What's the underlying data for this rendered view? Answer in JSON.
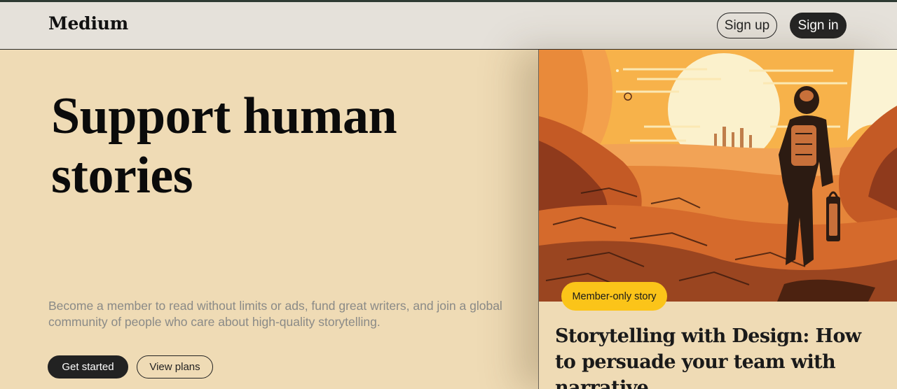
{
  "header": {
    "logo": "Medium",
    "signup_label": "Sign up",
    "signin_label": "Sign in"
  },
  "hero": {
    "title": "Support human stories",
    "subtitle": "Become a member to read without limits or ads, fund great writers, and join a global community of people who care about high-quality storytelling.",
    "get_started_label": "Get started",
    "view_plans_label": "View plans"
  },
  "featured": {
    "badge": "Member-only story",
    "title": "Storytelling with Design: How to persuade your team with narrative",
    "image": "illustration-astronaut-desert"
  },
  "colors": {
    "page_bg": "#efdbb5",
    "navbar_bg": "#e5e1da",
    "badge_bg": "#fbc419",
    "button_dark": "#242424"
  }
}
